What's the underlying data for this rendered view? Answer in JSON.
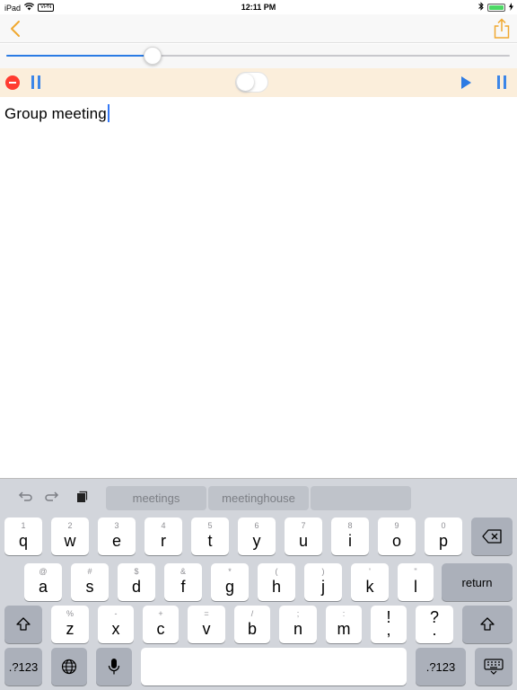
{
  "status_bar": {
    "device": "iPad",
    "vpn": "VPN",
    "time": "12:11 PM"
  },
  "nav": {
    "back_icon": "chevron-left-icon",
    "share_icon": "share-icon",
    "accent_color": "#f0a830"
  },
  "player": {
    "progress": 0.29,
    "toggle_on": false,
    "play_color": "#2d7be3",
    "control_bar_color": "#fbeedb"
  },
  "document": {
    "text": "Group meeting"
  },
  "keyboard": {
    "suggestions": [
      "meetings",
      "meetinghouse",
      ""
    ],
    "row1": [
      {
        "main": "q",
        "alt": "1"
      },
      {
        "main": "w",
        "alt": "2"
      },
      {
        "main": "e",
        "alt": "3"
      },
      {
        "main": "r",
        "alt": "4"
      },
      {
        "main": "t",
        "alt": "5"
      },
      {
        "main": "y",
        "alt": "6"
      },
      {
        "main": "u",
        "alt": "7"
      },
      {
        "main": "i",
        "alt": "8"
      },
      {
        "main": "o",
        "alt": "9"
      },
      {
        "main": "p",
        "alt": "0"
      }
    ],
    "row2": [
      {
        "main": "a",
        "alt": "@"
      },
      {
        "main": "s",
        "alt": "#"
      },
      {
        "main": "d",
        "alt": "$"
      },
      {
        "main": "f",
        "alt": "&"
      },
      {
        "main": "g",
        "alt": "*"
      },
      {
        "main": "h",
        "alt": "("
      },
      {
        "main": "j",
        "alt": ")"
      },
      {
        "main": "k",
        "alt": "'"
      },
      {
        "main": "l",
        "alt": "\""
      }
    ],
    "row3": [
      {
        "main": "z",
        "alt": "%"
      },
      {
        "main": "x",
        "alt": "-"
      },
      {
        "main": "c",
        "alt": "+"
      },
      {
        "main": "v",
        "alt": "="
      },
      {
        "main": "b",
        "alt": "/"
      },
      {
        "main": "n",
        "alt": ";"
      },
      {
        "main": "m",
        "alt": ":"
      },
      {
        "main": "!",
        "alt": ""
      },
      {
        "main": "?",
        "alt": ""
      }
    ],
    "punct_low": [
      ",",
      "."
    ],
    "return_label": "return",
    "numbers_label": ".?123"
  }
}
